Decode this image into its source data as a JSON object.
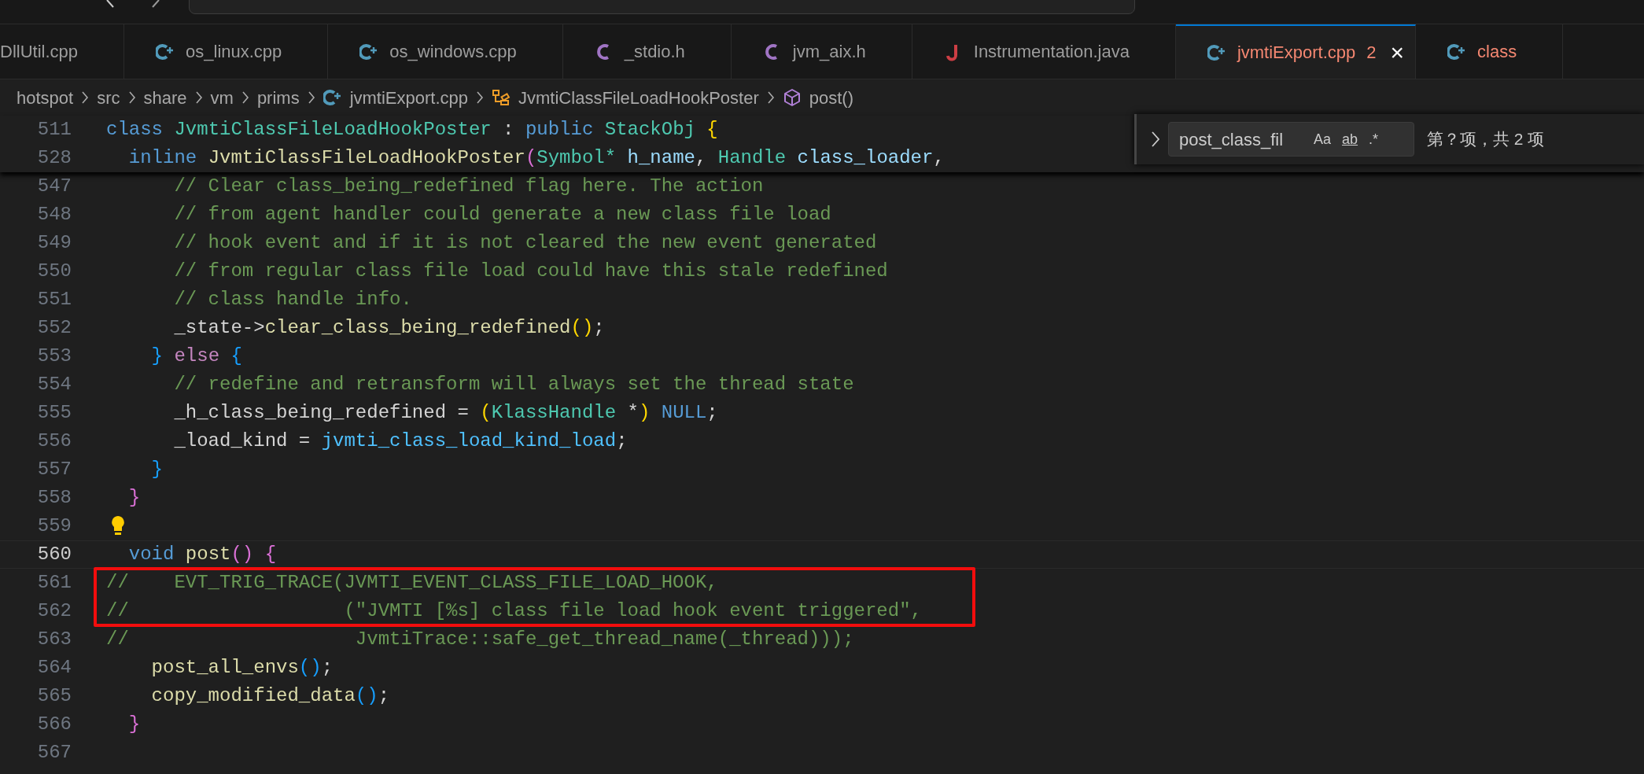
{
  "tabs": [
    {
      "label": "DllUtil.cpp",
      "selected": false
    },
    {
      "label": "os_linux.cpp",
      "kind": "cpp",
      "selected": false
    },
    {
      "label": "os_windows.cpp",
      "kind": "cpp",
      "selected": false
    },
    {
      "label": "_stdio.h",
      "kind": "c",
      "selected": false
    },
    {
      "label": "jvm_aix.h",
      "kind": "c",
      "selected": false
    },
    {
      "label": "Instrumentation.java",
      "kind": "java",
      "selected": false
    },
    {
      "label": "jvmtiExport.cpp",
      "kind": "cpp",
      "selected": true,
      "problems": "2",
      "close": "×",
      "error": true
    },
    {
      "label": "class",
      "kind": "cpp",
      "selected": false,
      "error": true
    }
  ],
  "breadcrumb": [
    {
      "label": "hotspot"
    },
    {
      "label": "src"
    },
    {
      "label": "share"
    },
    {
      "label": "vm"
    },
    {
      "label": "prims"
    },
    {
      "label": "jvmtiExport.cpp",
      "kind": "cpp"
    },
    {
      "label": "JvmtiClassFileLoadHookPoster",
      "kind": "struct"
    },
    {
      "label": "post()",
      "kind": "method"
    }
  ],
  "find_widget": {
    "value": "post_class_fil",
    "toggles": [
      "Aa",
      "ab",
      ".*"
    ],
    "result": "第？项，共 2 项"
  },
  "sticky_lines": [
    {
      "number": "511",
      "tokens": [
        {
          "text": "class ",
          "kind": "keyword"
        },
        {
          "text": "JvmtiClassFileLoadHookPoster",
          "kind": "type"
        },
        {
          "text": " : ",
          "kind": "plain"
        },
        {
          "text": "public ",
          "kind": "keyword"
        },
        {
          "text": "StackObj ",
          "kind": "type"
        },
        {
          "text": "{",
          "kind": "bracket1"
        }
      ]
    },
    {
      "number": "528",
      "tokens": [
        {
          "text": "  inline ",
          "kind": "keyword"
        },
        {
          "text": "JvmtiClassFileLoadHookPoster",
          "kind": "function"
        },
        {
          "text": "(",
          "kind": "bracket2"
        },
        {
          "text": "Symbol* ",
          "kind": "type"
        },
        {
          "text": "h_name",
          "kind": "variable"
        },
        {
          "text": ", ",
          "kind": "plain"
        },
        {
          "text": "Handle ",
          "kind": "type"
        },
        {
          "text": "class_loader",
          "kind": "variable"
        },
        {
          "text": ",",
          "kind": "plain"
        }
      ]
    }
  ],
  "lines": [
    {
      "number": "547",
      "tokens": [
        {
          "text": "      // Clear class_being_redefined flag here. The action",
          "kind": "comment"
        }
      ]
    },
    {
      "number": "548",
      "tokens": [
        {
          "text": "      // from agent handler could generate a new class file load",
          "kind": "comment"
        }
      ]
    },
    {
      "number": "549",
      "tokens": [
        {
          "text": "      // hook event and if it is not cleared the new event generated",
          "kind": "comment"
        }
      ]
    },
    {
      "number": "550",
      "tokens": [
        {
          "text": "      // from regular class file load could have this stale redefined",
          "kind": "comment"
        }
      ]
    },
    {
      "number": "551",
      "tokens": [
        {
          "text": "      // class handle info.",
          "kind": "comment"
        }
      ]
    },
    {
      "number": "552",
      "tokens": [
        {
          "text": "      _state->",
          "kind": "plain"
        },
        {
          "text": "clear_class_being_redefined",
          "kind": "function"
        },
        {
          "text": "()",
          "kind": "bracket1"
        },
        {
          "text": ";",
          "kind": "plain"
        }
      ]
    },
    {
      "number": "553",
      "tokens": [
        {
          "text": "    } ",
          "kind": "bracket3"
        },
        {
          "text": "else ",
          "kind": "control"
        },
        {
          "text": "{",
          "kind": "bracket3"
        }
      ]
    },
    {
      "number": "554",
      "tokens": [
        {
          "text": "      // redefine and retransform will always set the thread state",
          "kind": "comment"
        }
      ]
    },
    {
      "number": "555",
      "tokens": [
        {
          "text": "      _h_class_being_redefined = ",
          "kind": "plain"
        },
        {
          "text": "(",
          "kind": "bracket1"
        },
        {
          "text": "KlassHandle",
          "kind": "type"
        },
        {
          "text": " *",
          "kind": "plain"
        },
        {
          "text": ") ",
          "kind": "bracket1"
        },
        {
          "text": "NULL",
          "kind": "keyword"
        },
        {
          "text": ";",
          "kind": "plain"
        }
      ]
    },
    {
      "number": "556",
      "tokens": [
        {
          "text": "      _load_kind = ",
          "kind": "plain"
        },
        {
          "text": "jvmti_class_load_kind_load",
          "kind": "constant"
        },
        {
          "text": ";",
          "kind": "plain"
        }
      ]
    },
    {
      "number": "557",
      "tokens": [
        {
          "text": "    }",
          "kind": "bracket3"
        }
      ]
    },
    {
      "number": "558",
      "tokens": [
        {
          "text": "  }",
          "kind": "bracket2"
        }
      ]
    },
    {
      "number": "559",
      "lightbulb": true
    },
    {
      "number": "560",
      "current": true,
      "tokens": [
        {
          "text": "  void ",
          "kind": "keyword"
        },
        {
          "text": "post",
          "kind": "function"
        },
        {
          "text": "() {",
          "kind": "bracket2"
        }
      ]
    },
    {
      "number": "561",
      "boxed": true,
      "tokens": [
        {
          "text": "//    EVT_TRIG_TRACE(JVMTI_EVENT_CLASS_FILE_LOAD_HOOK,",
          "kind": "comment"
        }
      ]
    },
    {
      "number": "562",
      "boxed": true,
      "tokens": [
        {
          "text": "//                   (\"JVMTI [%s] class file load hook event triggered\",",
          "kind": "comment"
        }
      ]
    },
    {
      "number": "563",
      "tokens": [
        {
          "text": "//                    JvmtiTrace::safe_get_thread_name(_thread)));",
          "kind": "comment"
        }
      ]
    },
    {
      "number": "564",
      "tokens": [
        {
          "text": "    post_all_envs",
          "kind": "function"
        },
        {
          "text": "()",
          "kind": "bracket3"
        },
        {
          "text": ";",
          "kind": "plain"
        }
      ]
    },
    {
      "number": "565",
      "tokens": [
        {
          "text": "    copy_modified_data",
          "kind": "function"
        },
        {
          "text": "()",
          "kind": "bracket3"
        },
        {
          "text": ";",
          "kind": "plain"
        }
      ]
    },
    {
      "number": "566",
      "tokens": [
        {
          "text": "  }",
          "kind": "bracket2"
        }
      ]
    },
    {
      "number": "567"
    }
  ]
}
